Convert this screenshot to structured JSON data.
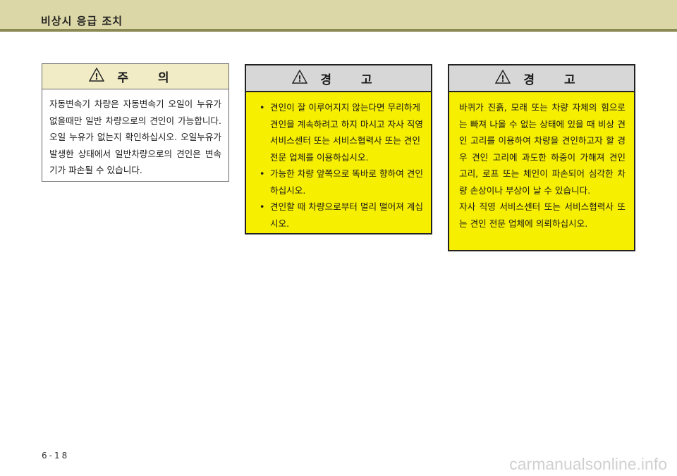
{
  "header": {
    "title": "비상시 응급 조치"
  },
  "caution": {
    "icon": "warning-triangle-icon",
    "title": "주 의",
    "text": "자동변속기 차량은 자동변속기 오일이 누유가 없을때만 일반 차량으로의 견인이 가능합니다. 오일 누유가 없는지 확인하십시오. 오일누유가 발생한 상태에서 일반차량으로의 견인은 변속기가 파손될 수 있습니다."
  },
  "warning1": {
    "icon": "warning-triangle-icon",
    "title": "경 고",
    "items": [
      "견인이 잘 이루어지지 않는다면 무리하게 견인을 계속하려고 하지 마시고 자사 직영 서비스센터 또는 서비스협력사 또는 견인전문 업체를 이용하십시오.",
      "가능한 차량 앞쪽으로 똑바로 향하여 견인하십시오.",
      "견인할 때 차량으로부터 멀리 떨어져 계십시오."
    ]
  },
  "warning2": {
    "icon": "warning-triangle-icon",
    "title": "경 고",
    "para1": "바퀴가 진흙, 모래 또는 차량 자체의 힘으로는 빠져 나올 수 없는 상태에 있을 때 비상 견인 고리를 이용하여 차량을 견인하고자 할 경우 견인 고리에 과도한 하중이 가해져 견인 고리, 로프 또는 체인이 파손되어 심각한 차량 손상이나 부상이 날 수 있습니다.",
    "para2": "자사 직영 서비스센터 또는 서비스협력사 또는 견인 전문 업체에 의뢰하십시오."
  },
  "footer": {
    "page_number": "6-18"
  },
  "watermark": "carmanualsonline.info",
  "colors": {
    "header_band": "#dcd7a6",
    "caution_head": "#f1ecc6",
    "warning_fill": "#f7ef00",
    "warning_head": "#d7d7d7"
  }
}
